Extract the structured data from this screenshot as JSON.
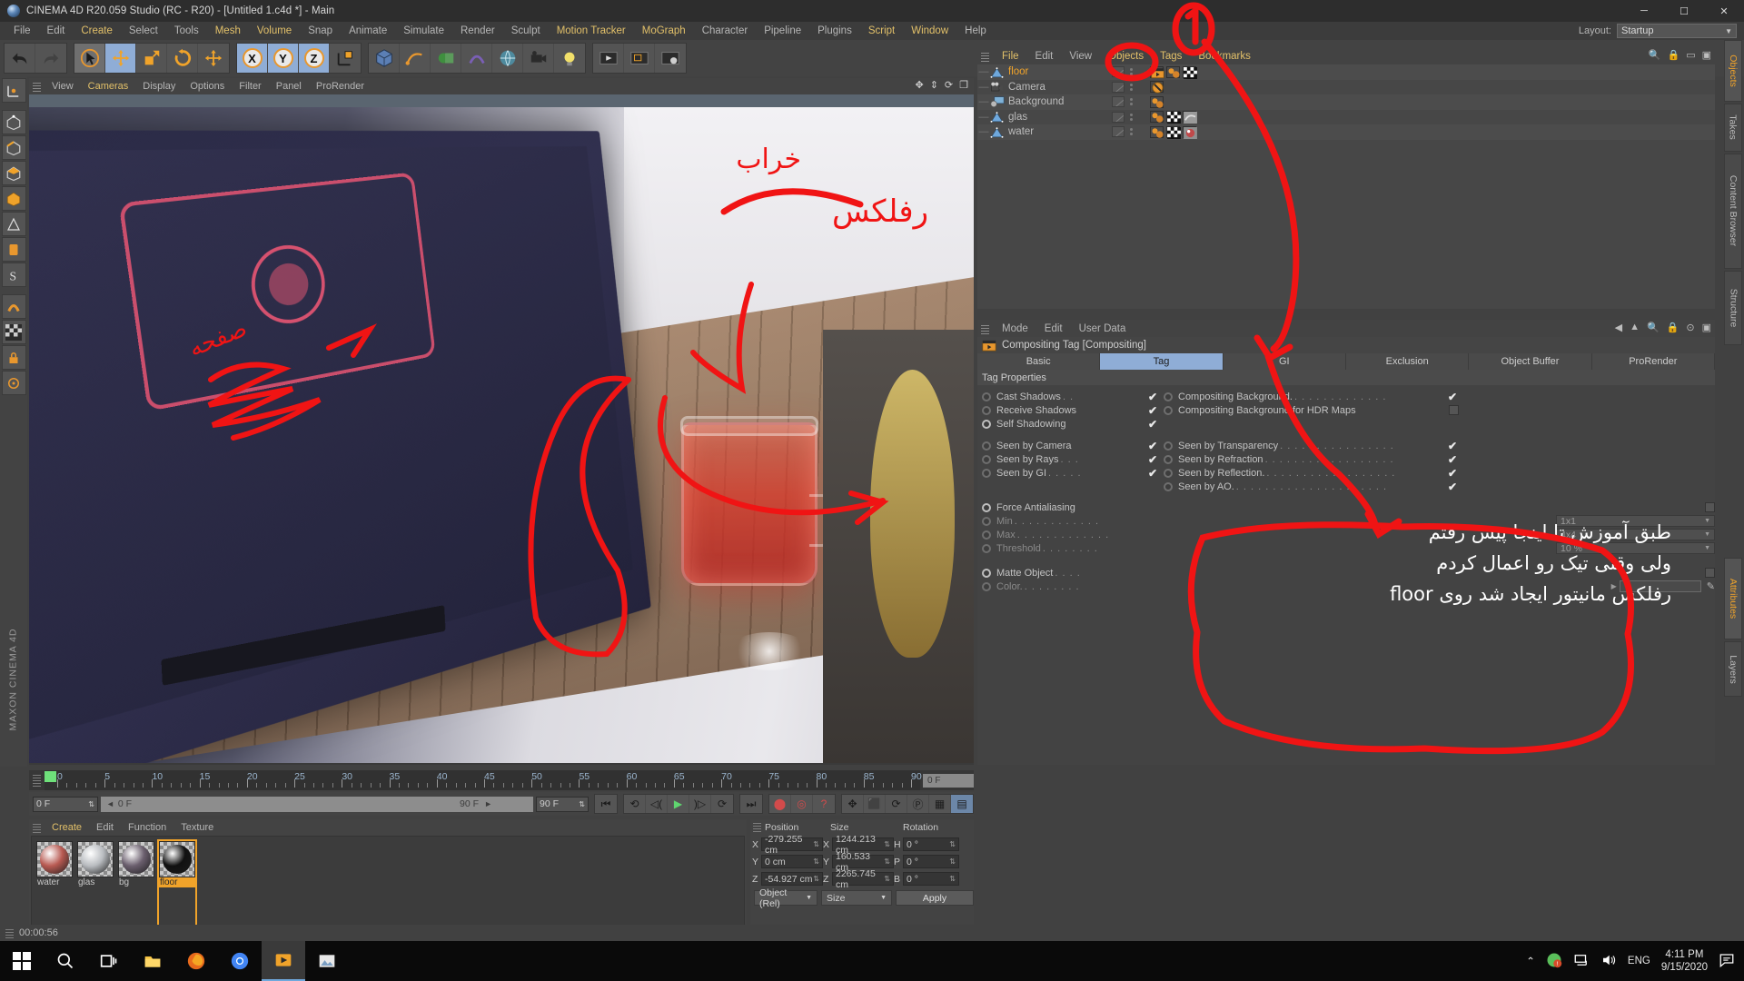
{
  "window": {
    "title": "CINEMA 4D R20.059 Studio (RC - R20) - [Untitled 1.c4d *] - Main",
    "minimize": "─",
    "maximize": "☐",
    "close": "✕"
  },
  "menubar": {
    "items": [
      {
        "label": "File",
        "style": "grey"
      },
      {
        "label": "Edit",
        "style": "grey"
      },
      {
        "label": "Create",
        "style": "gold"
      },
      {
        "label": "Select",
        "style": "grey"
      },
      {
        "label": "Tools",
        "style": "grey"
      },
      {
        "label": "Mesh",
        "style": "gold"
      },
      {
        "label": "Volume",
        "style": "gold"
      },
      {
        "label": "Snap",
        "style": "grey"
      },
      {
        "label": "Animate",
        "style": "grey"
      },
      {
        "label": "Simulate",
        "style": "grey"
      },
      {
        "label": "Render",
        "style": "grey"
      },
      {
        "label": "Sculpt",
        "style": "grey"
      },
      {
        "label": "Motion Tracker",
        "style": "gold"
      },
      {
        "label": "MoGraph",
        "style": "gold"
      },
      {
        "label": "Character",
        "style": "grey"
      },
      {
        "label": "Pipeline",
        "style": "grey"
      },
      {
        "label": "Plugins",
        "style": "grey"
      },
      {
        "label": "Script",
        "style": "gold"
      },
      {
        "label": "Window",
        "style": "gold"
      },
      {
        "label": "Help",
        "style": "grey"
      }
    ],
    "layout_label": "Layout:",
    "layout_value": "Startup"
  },
  "viewport": {
    "menu": [
      "View",
      "Cameras",
      "Display",
      "Options",
      "Filter",
      "Panel",
      "ProRender"
    ],
    "gold_menu": [
      "Cameras"
    ]
  },
  "timeline": {
    "ticks": [
      0,
      5,
      10,
      15,
      20,
      25,
      30,
      35,
      40,
      45,
      50,
      55,
      60,
      65,
      70,
      75,
      80,
      85,
      90
    ],
    "end_frame_label": "0 F",
    "current_frame": "0 F",
    "slider_value": "0 F",
    "range_end": "90 F",
    "preview_end": "90 F"
  },
  "materials": {
    "menu": [
      "Create",
      "Edit",
      "Function",
      "Texture"
    ],
    "items": [
      {
        "name": "water",
        "selected": false,
        "color": "#b85a52"
      },
      {
        "name": "glas",
        "selected": false,
        "color": "#b9bcc0"
      },
      {
        "name": "bg",
        "selected": false,
        "color": "#6b5f6e"
      },
      {
        "name": "floor",
        "selected": true,
        "color": "#111111"
      }
    ]
  },
  "coordinates": {
    "headers": [
      "Position",
      "Size",
      "Rotation"
    ],
    "rows": [
      {
        "axis": "X",
        "position": "-279.255 cm",
        "size_axis": "X",
        "size": "1244.213 cm",
        "rot_axis": "H",
        "rotation": "0 °"
      },
      {
        "axis": "Y",
        "position": "0 cm",
        "size_axis": "Y",
        "size": "160.533 cm",
        "rot_axis": "P",
        "rotation": "0 °"
      },
      {
        "axis": "Z",
        "position": "-54.927 cm",
        "size_axis": "Z",
        "size": "2265.745 cm",
        "rot_axis": "B",
        "rotation": "0 °"
      }
    ],
    "mode_dropdown": "Object (Rel)",
    "size_dropdown": "Size",
    "apply_button": "Apply"
  },
  "object_manager": {
    "menu": [
      "File",
      "Edit",
      "View",
      "Objects",
      "Tags",
      "Bookmarks"
    ],
    "gold_menu": [
      "File",
      "Objects",
      "Tags",
      "Bookmarks"
    ],
    "objects": [
      {
        "name": "floor",
        "icon": "polygon-object-icon",
        "selected": true,
        "tags": [
          "compositing-tag",
          "material-tag",
          "checker-texture-tag"
        ]
      },
      {
        "name": "Camera",
        "icon": "camera-object-icon",
        "selected": false,
        "tags": [
          "protection-tag"
        ]
      },
      {
        "name": "Background",
        "icon": "background-object-icon",
        "selected": false,
        "tags": [
          "material-tag"
        ]
      },
      {
        "name": "glas",
        "icon": "polygon-object-icon",
        "selected": false,
        "tags": [
          "material-tag",
          "checker-texture-tag",
          "glass-texture-tag"
        ]
      },
      {
        "name": "water",
        "icon": "polygon-object-icon",
        "selected": false,
        "tags": [
          "material-tag",
          "checker-texture-tag",
          "water-texture-tag"
        ]
      }
    ]
  },
  "attribute_manager": {
    "menu": [
      "Mode",
      "Edit",
      "User Data"
    ],
    "title": "Compositing Tag [Compositing]",
    "tabs": [
      {
        "label": "Basic",
        "active": false
      },
      {
        "label": "Tag",
        "active": true
      },
      {
        "label": "GI",
        "active": false
      },
      {
        "label": "Exclusion",
        "active": false
      },
      {
        "label": "Object Buffer",
        "active": false
      },
      {
        "label": "ProRender",
        "active": false
      }
    ],
    "section_title": "Tag Properties",
    "left_props": [
      {
        "label": "Cast Shadows",
        "dots": " . .",
        "checked": true,
        "radio": "off"
      },
      {
        "label": "Receive Shadows",
        "dots": "",
        "checked": true,
        "radio": "off"
      },
      {
        "label": "Self Shadowing",
        "dots": "",
        "checked": true,
        "radio": "on"
      },
      {
        "label": "Seen by Camera",
        "dots": "",
        "checked": true,
        "radio": "off"
      },
      {
        "label": "Seen by Rays",
        "dots": " . . .",
        "checked": true,
        "radio": "off"
      },
      {
        "label": "Seen by GI",
        "dots": " . . . . .",
        "checked": true,
        "radio": "off"
      }
    ],
    "right_props": [
      {
        "label": "Compositing Background.",
        "dots": " . . . . . . . . . . . . .",
        "checked": true,
        "radio": "off"
      },
      {
        "label": "Compositing Background for HDR Maps",
        "dots": "",
        "checked": false,
        "radio": "off"
      },
      {
        "label": "Seen by Transparency",
        "dots": " . . . . . . . . . . . . . . . .",
        "checked": true,
        "radio": "off"
      },
      {
        "label": "Seen by Refraction",
        "dots": " . . . . . . . . . . . . . . . . . .",
        "checked": true,
        "radio": "off"
      },
      {
        "label": "Seen by Reflection.",
        "dots": " . . . . . . . . . . . . . . . . . .",
        "checked": true,
        "radio": "off"
      },
      {
        "label": "Seen by AO.",
        "dots": " . . . . . . . . . . . . . . . . . . . . .",
        "checked": true,
        "radio": "off"
      }
    ],
    "aa_props": [
      {
        "label": "Force Antialiasing",
        "dots": "",
        "radio": "on",
        "type": "checkbox",
        "value": null,
        "dim": false
      },
      {
        "label": "Min",
        "dots": " . . . . . . . . . . . .",
        "radio": "off",
        "type": "field",
        "value": "1x1",
        "dim": true
      },
      {
        "label": "Max",
        "dots": " . . . . . . . . . . . . .",
        "radio": "off",
        "type": "field",
        "value": "4x4",
        "dim": true
      },
      {
        "label": "Threshold",
        "dots": " . . . . . . . .",
        "radio": "off",
        "type": "field",
        "value": "10 %",
        "dim": true
      },
      {
        "label": "Matte Object",
        "dots": " . . . .",
        "radio": "on",
        "type": "checkbox",
        "value": null,
        "dim": false
      },
      {
        "label": "Color.",
        "dots": " . . . . . . . .",
        "radio": "off",
        "type": "color",
        "value": "",
        "dim": true
      }
    ]
  },
  "right_tabs": [
    {
      "label": "Objects",
      "active": true
    },
    {
      "label": "Takes",
      "active": false
    },
    {
      "label": "Content Browser",
      "active": false
    },
    {
      "label": "Structure",
      "active": false
    },
    {
      "label": "Attributes",
      "active": true
    },
    {
      "label": "Layers",
      "active": false
    }
  ],
  "status_bar": {
    "text": "00:00:56"
  },
  "taskbar": {
    "language": "ENG",
    "time": "4:11 PM",
    "date": "9/15/2020",
    "icons": [
      "start-icon",
      "search-icon",
      "task-view-icon",
      "file-explorer-icon",
      "firefox-icon",
      "chrome-icon",
      "media-player-icon",
      "photos-icon"
    ]
  },
  "annotations": {
    "persian_line1": "طبق آموزش تا اینجا پیش رفتم",
    "persian_line2": "ولی وقتی تیک رو اعمال کردم",
    "persian_line3": "رفلکس مانیتور ایجاد شد روی floor",
    "viewport_label1": "رفلکس",
    "viewport_label2": "خراب",
    "viewport_label3": "صفحه",
    "pen_color": "#f01414"
  }
}
